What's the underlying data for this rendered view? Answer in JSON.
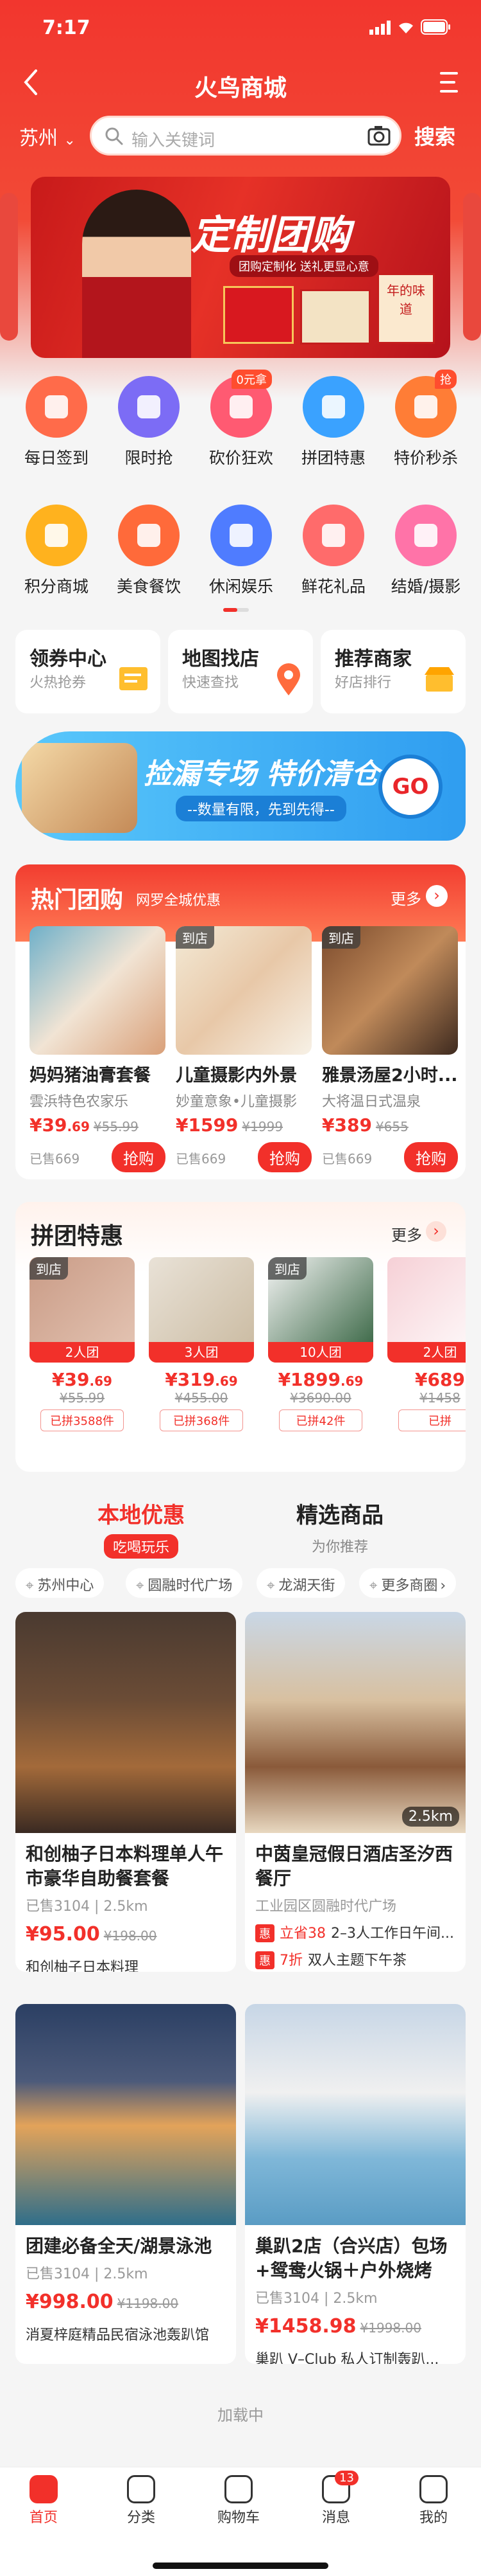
{
  "status": {
    "time": "7:17"
  },
  "nav": {
    "title": "火鸟商城"
  },
  "search": {
    "city": "苏州",
    "placeholder": "输入关键词",
    "button": "搜索"
  },
  "banner": {
    "headline": "定制团购",
    "sub": "团购定制化 送礼更显心意",
    "box_text": "年的味道"
  },
  "grid": [
    {
      "label": "每日签到",
      "icon": "calendar-icon",
      "color": "#ff6b4a",
      "tag": ""
    },
    {
      "label": "限时抢",
      "icon": "lightning-bear-icon",
      "color": "#7c6cf5",
      "tag": ""
    },
    {
      "label": "砍价狂欢",
      "icon": "cut-icon",
      "color": "#ff5a72",
      "tag": "0元拿"
    },
    {
      "label": "拼团特惠",
      "icon": "smile-icon",
      "color": "#3aa2ff",
      "tag": ""
    },
    {
      "label": "特价秒杀",
      "icon": "seckill-icon",
      "color": "#ff7d36",
      "tag": "抢"
    },
    {
      "label": "积分商城",
      "icon": "basket-icon",
      "color": "#ffb21e",
      "tag": ""
    },
    {
      "label": "美食餐饮",
      "icon": "food-icon",
      "color": "#ff6a3a",
      "tag": ""
    },
    {
      "label": "休闲娱乐",
      "icon": "music-icon",
      "color": "#4f7cff",
      "tag": ""
    },
    {
      "label": "鲜花礼品",
      "icon": "flower-icon",
      "color": "#ff6b6b",
      "tag": ""
    },
    {
      "label": "结婚/摄影",
      "icon": "heart-icon",
      "color": "#ff73a8",
      "tag": ""
    }
  ],
  "cards": [
    {
      "title": "领券中心",
      "sub": "火热抢券"
    },
    {
      "title": "地图找店",
      "sub": "快速查找"
    },
    {
      "title": "推荐商家",
      "sub": "好店排行"
    }
  ],
  "promo": {
    "title": "捡漏专场 特价清仓",
    "sub": "--数量有限，先到先得--",
    "go": "GO"
  },
  "hot": {
    "title": "热门团购",
    "sub": "网罗全城优惠",
    "more": "更多",
    "items": [
      {
        "badge": "",
        "name": "妈妈猪油膏套餐",
        "shop": "雲浜特色农家乐",
        "price_int": "39",
        "price_dec": ".69",
        "old": "¥55.99",
        "sold": "已售669",
        "buy": "抢购"
      },
      {
        "badge": "到店",
        "name": "儿童摄影内外景",
        "shop": "妙童意象•儿童摄影",
        "price_int": "1599",
        "price_dec": "",
        "old": "¥1999",
        "sold": "已售669",
        "buy": "抢购"
      },
      {
        "badge": "到店",
        "name": "雅景汤屋2小时...",
        "shop": "大将温日式温泉",
        "price_int": "389",
        "price_dec": "",
        "old": "¥655",
        "sold": "已售669",
        "buy": "抢购"
      }
    ]
  },
  "group": {
    "title": "拼团特惠",
    "more": "更多",
    "items": [
      {
        "badge": "到店",
        "team": "2人团",
        "price_int": "39",
        "price_dec": ".69",
        "old": "¥55.99",
        "sold": "已拼3588件"
      },
      {
        "badge": "",
        "team": "3人团",
        "price_int": "319",
        "price_dec": ".69",
        "old": "¥455.00",
        "sold": "已拼368件"
      },
      {
        "badge": "到店",
        "team": "10人团",
        "price_int": "1899",
        "price_dec": ".69",
        "old": "¥3690.00",
        "sold": "已拼42件"
      },
      {
        "badge": "",
        "team": "2人团",
        "price_int": "689",
        "price_dec": "",
        "old": "¥1458",
        "sold": "已拼"
      }
    ]
  },
  "section_tabs": [
    {
      "title": "本地优惠",
      "sub": "吃喝玩乐"
    },
    {
      "title": "精选商品",
      "sub": "为你推荐"
    }
  ],
  "chips": [
    "苏州中心",
    "圆融时代广场",
    "龙湖天街",
    "更多商圈"
  ],
  "feed": [
    {
      "name": "和创柚子日本料理单人午市豪华自助餐套餐",
      "sold": "已售3104",
      "dist": "2.5km",
      "price": "95.00",
      "old": "¥198.00",
      "shop": "和创柚子日本料理",
      "promos": []
    },
    {
      "name": "中茵皇冠假日酒店圣汐西餐厅",
      "sold": "工业园区圆融时代广场",
      "dist": "2.5km",
      "price": "",
      "old": "",
      "shop": "",
      "promos": [
        {
          "k": "惠",
          "t": "立省38",
          "d": "2–3人工作日午间..."
        },
        {
          "k": "惠",
          "t": "7折",
          "d": "双人主题下午茶"
        }
      ]
    },
    {
      "name": "团建必备全天/湖景泳池",
      "sold": "已售3104",
      "dist": "2.5km",
      "price": "998.00",
      "old": "¥1198.00",
      "shop": "消夏梓庭精品民宿泳池轰趴馆",
      "promos": []
    },
    {
      "name": "巢趴2店（合兴店）包场+鸳鸯火锅＋户外烧烤",
      "sold": "已售3104",
      "dist": "2.5km",
      "price": "1458.98",
      "old": "¥1998.00",
      "shop": "巢趴 V–Club 私人订制轰趴...",
      "promos": []
    }
  ],
  "loading": "加载中",
  "tabs": [
    {
      "label": "首页",
      "icon": "home-icon",
      "active": true
    },
    {
      "label": "分类",
      "icon": "category-icon",
      "active": false
    },
    {
      "label": "购物车",
      "icon": "cart-icon",
      "active": false
    },
    {
      "label": "消息",
      "icon": "message-icon",
      "active": false,
      "badge": "13"
    },
    {
      "label": "我的",
      "icon": "profile-icon",
      "active": false
    }
  ],
  "colors": {
    "brand": "#f2302a",
    "bg": "#f5f5f5"
  }
}
